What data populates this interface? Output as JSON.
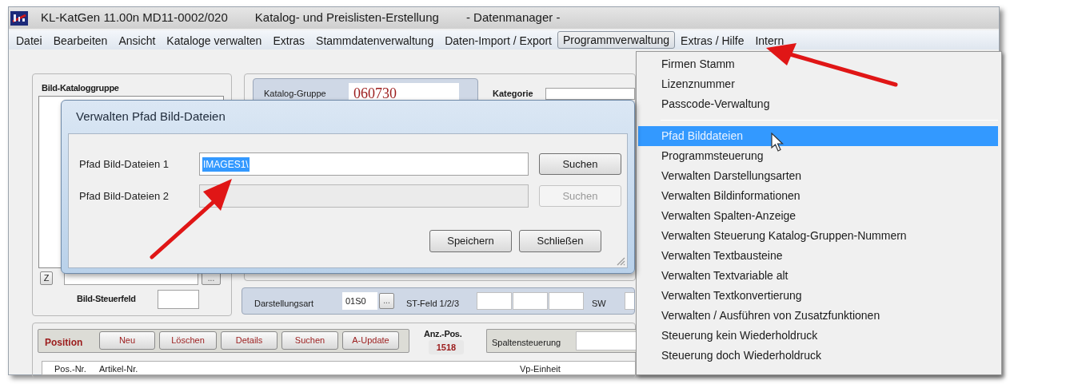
{
  "window": {
    "title_parts": [
      "KL-KatGen 11.00n MD11-0002/020",
      "Katalog- und Preislisten-Erstellung",
      "- Datenmanager -"
    ]
  },
  "menu_bar": [
    {
      "label": "Datei",
      "selected": false
    },
    {
      "label": "Bearbeiten",
      "selected": false
    },
    {
      "label": "Ansicht",
      "selected": false
    },
    {
      "label": "Kataloge verwalten",
      "selected": false
    },
    {
      "label": "Extras",
      "selected": false
    },
    {
      "label": "Stammdatenverwaltung",
      "selected": false
    },
    {
      "label": "Daten-Import / Export",
      "selected": false
    },
    {
      "label": "Programmverwaltung",
      "selected": true
    },
    {
      "label": "Extras / Hilfe",
      "selected": false
    },
    {
      "label": "Intern",
      "selected": false
    }
  ],
  "dropdown_menu": [
    {
      "kind": "item",
      "label": "Firmen Stamm",
      "selected": false
    },
    {
      "kind": "item",
      "label": "Lizenznummer",
      "selected": false
    },
    {
      "kind": "item",
      "label": "Passcode-Verwaltung",
      "selected": false
    },
    {
      "kind": "separator"
    },
    {
      "kind": "item",
      "label": "Pfad Bilddateien",
      "selected": true
    },
    {
      "kind": "item",
      "label": "Programmsteuerung",
      "selected": false
    },
    {
      "kind": "item",
      "label": "Verwalten  Darstellungsarten",
      "selected": false
    },
    {
      "kind": "item",
      "label": "Verwalten Bildinformationen",
      "selected": false
    },
    {
      "kind": "item",
      "label": "Verwalten Spalten-Anzeige",
      "selected": false
    },
    {
      "kind": "item",
      "label": "Verwalten Steuerung Katalog-Gruppen-Nummern",
      "selected": false
    },
    {
      "kind": "item",
      "label": "Verwalten Textbausteine",
      "selected": false
    },
    {
      "kind": "item",
      "label": "Verwalten Textvariable alt",
      "selected": false
    },
    {
      "kind": "item",
      "label": "Verwalten Textkonvertierung",
      "selected": false
    },
    {
      "kind": "item",
      "label": "Verwalten / Ausführen von  Zusatzfunktionen",
      "selected": false
    },
    {
      "kind": "item",
      "label": "Steuerung kein Wiederholdruck",
      "selected": false
    },
    {
      "kind": "item",
      "label": "Steuerung doch Wiederholdruck",
      "selected": false
    }
  ],
  "form": {
    "bild_kataloggruppe": {
      "title": "Bild-Kataloggruppe",
      "z_button": "Z",
      "more_button": "...",
      "steuerfeld_label": "Bild-Steuerfeld"
    },
    "katalog_gruppe": {
      "label": "Katalog-Gruppe",
      "value": "060730"
    },
    "kategorie": {
      "label": "Kategorie"
    },
    "darstellung": {
      "label": "Darstellungsart",
      "value": "01S0",
      "more_button": "...",
      "st_feld_label": "ST-Feld 1/2/3",
      "sw_label": "SW"
    },
    "position": {
      "label": "Position",
      "buttons": [
        "Neu",
        "Löschen",
        "Details",
        "Suchen",
        "A-Update"
      ]
    },
    "anz_pos": {
      "label": "Anz.-Pos.",
      "value": "1518"
    },
    "spaltensteuerung": {
      "label": "Spaltensteuerung"
    },
    "table": {
      "columns": [
        "Pos.-Nr.",
        "Artikel-Nr.",
        "Vp-Einheit"
      ]
    }
  },
  "dialog": {
    "title": "Verwalten Pfad Bild-Dateien",
    "rows": [
      {
        "label": "Pfad Bild-Dateien 1",
        "value": "IMAGES1\\",
        "text_selected": true,
        "disabled": false,
        "button": "Suchen"
      },
      {
        "label": "Pfad Bild-Dateien 2",
        "disabled": true,
        "button": "Suchen"
      }
    ],
    "buttons": [
      "Speichern",
      "Schließen"
    ]
  }
}
